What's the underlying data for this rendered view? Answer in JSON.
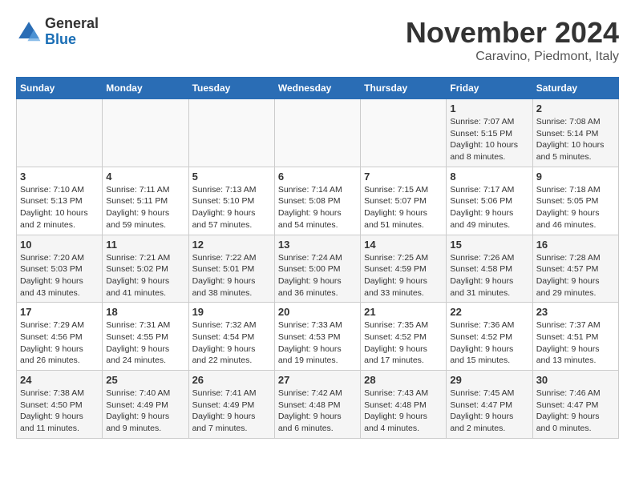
{
  "header": {
    "logo_general": "General",
    "logo_blue": "Blue",
    "title": "November 2024",
    "subtitle": "Caravino, Piedmont, Italy"
  },
  "days_of_week": [
    "Sunday",
    "Monday",
    "Tuesday",
    "Wednesday",
    "Thursday",
    "Friday",
    "Saturday"
  ],
  "weeks": [
    [
      {
        "day": "",
        "info": ""
      },
      {
        "day": "",
        "info": ""
      },
      {
        "day": "",
        "info": ""
      },
      {
        "day": "",
        "info": ""
      },
      {
        "day": "",
        "info": ""
      },
      {
        "day": "1",
        "info": "Sunrise: 7:07 AM\nSunset: 5:15 PM\nDaylight: 10 hours and 8 minutes."
      },
      {
        "day": "2",
        "info": "Sunrise: 7:08 AM\nSunset: 5:14 PM\nDaylight: 10 hours and 5 minutes."
      }
    ],
    [
      {
        "day": "3",
        "info": "Sunrise: 7:10 AM\nSunset: 5:13 PM\nDaylight: 10 hours and 2 minutes."
      },
      {
        "day": "4",
        "info": "Sunrise: 7:11 AM\nSunset: 5:11 PM\nDaylight: 9 hours and 59 minutes."
      },
      {
        "day": "5",
        "info": "Sunrise: 7:13 AM\nSunset: 5:10 PM\nDaylight: 9 hours and 57 minutes."
      },
      {
        "day": "6",
        "info": "Sunrise: 7:14 AM\nSunset: 5:08 PM\nDaylight: 9 hours and 54 minutes."
      },
      {
        "day": "7",
        "info": "Sunrise: 7:15 AM\nSunset: 5:07 PM\nDaylight: 9 hours and 51 minutes."
      },
      {
        "day": "8",
        "info": "Sunrise: 7:17 AM\nSunset: 5:06 PM\nDaylight: 9 hours and 49 minutes."
      },
      {
        "day": "9",
        "info": "Sunrise: 7:18 AM\nSunset: 5:05 PM\nDaylight: 9 hours and 46 minutes."
      }
    ],
    [
      {
        "day": "10",
        "info": "Sunrise: 7:20 AM\nSunset: 5:03 PM\nDaylight: 9 hours and 43 minutes."
      },
      {
        "day": "11",
        "info": "Sunrise: 7:21 AM\nSunset: 5:02 PM\nDaylight: 9 hours and 41 minutes."
      },
      {
        "day": "12",
        "info": "Sunrise: 7:22 AM\nSunset: 5:01 PM\nDaylight: 9 hours and 38 minutes."
      },
      {
        "day": "13",
        "info": "Sunrise: 7:24 AM\nSunset: 5:00 PM\nDaylight: 9 hours and 36 minutes."
      },
      {
        "day": "14",
        "info": "Sunrise: 7:25 AM\nSunset: 4:59 PM\nDaylight: 9 hours and 33 minutes."
      },
      {
        "day": "15",
        "info": "Sunrise: 7:26 AM\nSunset: 4:58 PM\nDaylight: 9 hours and 31 minutes."
      },
      {
        "day": "16",
        "info": "Sunrise: 7:28 AM\nSunset: 4:57 PM\nDaylight: 9 hours and 29 minutes."
      }
    ],
    [
      {
        "day": "17",
        "info": "Sunrise: 7:29 AM\nSunset: 4:56 PM\nDaylight: 9 hours and 26 minutes."
      },
      {
        "day": "18",
        "info": "Sunrise: 7:31 AM\nSunset: 4:55 PM\nDaylight: 9 hours and 24 minutes."
      },
      {
        "day": "19",
        "info": "Sunrise: 7:32 AM\nSunset: 4:54 PM\nDaylight: 9 hours and 22 minutes."
      },
      {
        "day": "20",
        "info": "Sunrise: 7:33 AM\nSunset: 4:53 PM\nDaylight: 9 hours and 19 minutes."
      },
      {
        "day": "21",
        "info": "Sunrise: 7:35 AM\nSunset: 4:52 PM\nDaylight: 9 hours and 17 minutes."
      },
      {
        "day": "22",
        "info": "Sunrise: 7:36 AM\nSunset: 4:52 PM\nDaylight: 9 hours and 15 minutes."
      },
      {
        "day": "23",
        "info": "Sunrise: 7:37 AM\nSunset: 4:51 PM\nDaylight: 9 hours and 13 minutes."
      }
    ],
    [
      {
        "day": "24",
        "info": "Sunrise: 7:38 AM\nSunset: 4:50 PM\nDaylight: 9 hours and 11 minutes."
      },
      {
        "day": "25",
        "info": "Sunrise: 7:40 AM\nSunset: 4:49 PM\nDaylight: 9 hours and 9 minutes."
      },
      {
        "day": "26",
        "info": "Sunrise: 7:41 AM\nSunset: 4:49 PM\nDaylight: 9 hours and 7 minutes."
      },
      {
        "day": "27",
        "info": "Sunrise: 7:42 AM\nSunset: 4:48 PM\nDaylight: 9 hours and 6 minutes."
      },
      {
        "day": "28",
        "info": "Sunrise: 7:43 AM\nSunset: 4:48 PM\nDaylight: 9 hours and 4 minutes."
      },
      {
        "day": "29",
        "info": "Sunrise: 7:45 AM\nSunset: 4:47 PM\nDaylight: 9 hours and 2 minutes."
      },
      {
        "day": "30",
        "info": "Sunrise: 7:46 AM\nSunset: 4:47 PM\nDaylight: 9 hours and 0 minutes."
      }
    ]
  ]
}
